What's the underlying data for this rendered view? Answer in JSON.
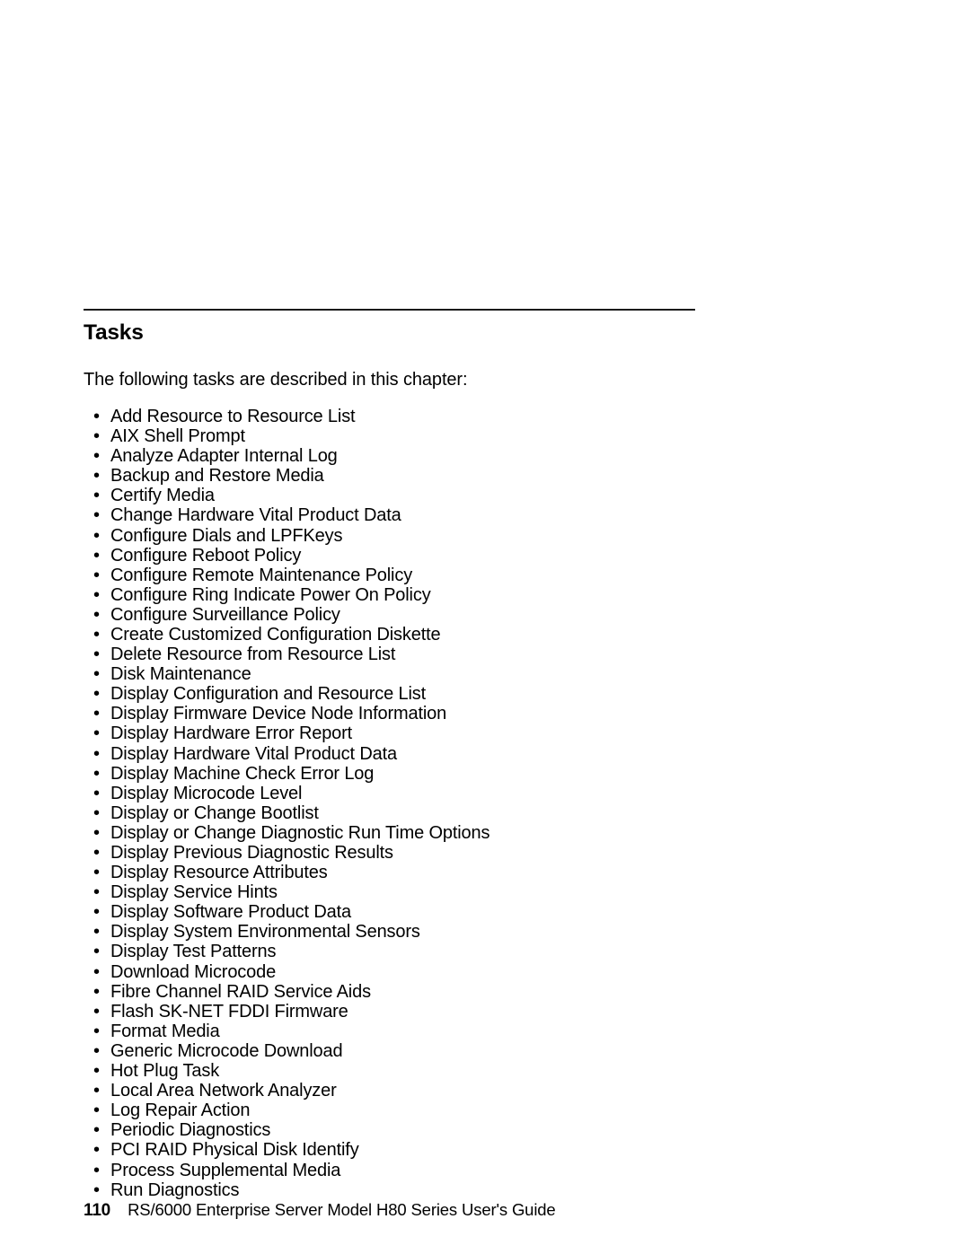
{
  "document": {
    "section": {
      "heading": "Tasks",
      "intro": "The following tasks are described in this chapter:",
      "bullet_glyph": "•",
      "tasks": [
        "Add Resource to Resource List",
        "AIX Shell Prompt",
        "Analyze Adapter Internal Log",
        "Backup and Restore Media",
        "Certify Media",
        "Change Hardware Vital Product Data",
        "Configure Dials and LPFKeys",
        "Configure Reboot Policy",
        "Configure Remote Maintenance Policy",
        "Configure Ring Indicate Power On Policy",
        "Configure Surveillance Policy",
        "Create Customized Configuration Diskette",
        "Delete Resource from Resource List",
        "Disk Maintenance",
        "Display Configuration and Resource List",
        "Display Firmware Device Node Information",
        "Display Hardware Error Report",
        "Display Hardware Vital Product Data",
        "Display Machine Check Error Log",
        "Display Microcode Level",
        "Display or Change Bootlist",
        "Display or Change Diagnostic Run Time Options",
        "Display Previous Diagnostic Results",
        "Display Resource Attributes",
        "Display Service Hints",
        "Display Software Product Data",
        "Display System Environmental Sensors",
        "Display Test Patterns",
        "Download Microcode",
        "Fibre Channel RAID Service Aids",
        "Flash SK-NET FDDI Firmware",
        "Format Media",
        "Generic Microcode Download",
        "Hot Plug Task",
        "Local Area Network Analyzer",
        "Log Repair Action",
        "Periodic Diagnostics",
        "PCI RAID Physical Disk Identify",
        "Process Supplemental Media",
        "Run Diagnostics"
      ]
    },
    "footer": {
      "page_number": "110",
      "book_title": "RS/6000 Enterprise Server Model H80 Series User's Guide"
    }
  }
}
